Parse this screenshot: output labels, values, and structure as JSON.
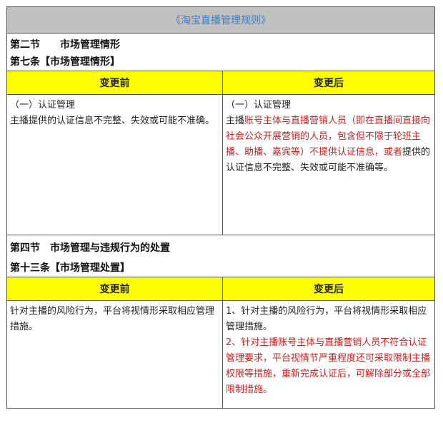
{
  "title": "《淘宝直播管理规则》",
  "section1": {
    "heading": "第二节　　市场管理情形",
    "article": "第七条【市场管理情形】",
    "before_label": "变更前",
    "after_label": "变更后",
    "before": {
      "line1": "（一）认证管理",
      "line2": "主播提供的认证信息不完整、失效或可能不准确。"
    },
    "after": {
      "line1": "（一）认证管理",
      "p1": "主播",
      "red1": "账号主体与直播营销人员（即在直播间直接向社会公众开展营销的人员，包含但不限于轮班主播、助播、嘉宾等）不提供认证信息，或者",
      "p2": "提供的认证信息不完整、失效或可能不准确等。"
    }
  },
  "section2": {
    "heading": "第四节　市场管理与违规行为的处置",
    "article": "第十三条【市场管理处置】",
    "before_label": "变更前",
    "after_label": "变更后",
    "before": {
      "text": "针对主播的风险行为，平台将视情形采取相应管理措施。"
    },
    "after": {
      "item1": "1、针对主播的风险行为，平台将视情形采取相应管理措施。",
      "item2_prefix": "2、",
      "item2_red": "针对主播账号主体与直播营销人员不符合认证管理要求，平台视情节严重程度还可采取限制主播权限等措施，重新完成认证后，可解除部分或全部限制措施。"
    }
  }
}
